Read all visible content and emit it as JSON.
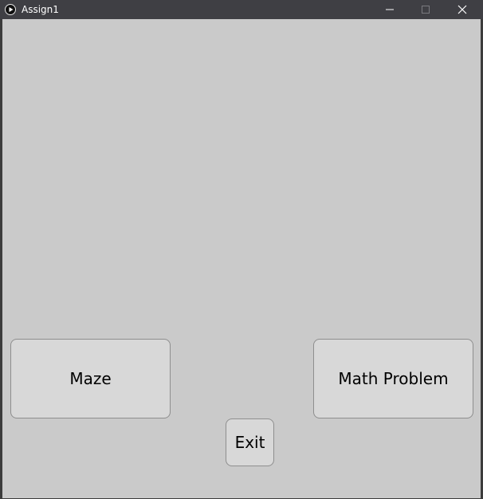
{
  "window": {
    "title": "Assign1",
    "controls": {
      "minimize": "minimize-icon",
      "maximize": "maximize-icon",
      "close": "close-icon"
    }
  },
  "buttons": {
    "maze_label": "Maze",
    "math_label": "Math Problem",
    "exit_label": "Exit"
  },
  "colors": {
    "titlebar": "#3f3f44",
    "client_background": "#cacaca",
    "button_fill": "#d8d8d8",
    "button_border": "#8e8e8e"
  }
}
